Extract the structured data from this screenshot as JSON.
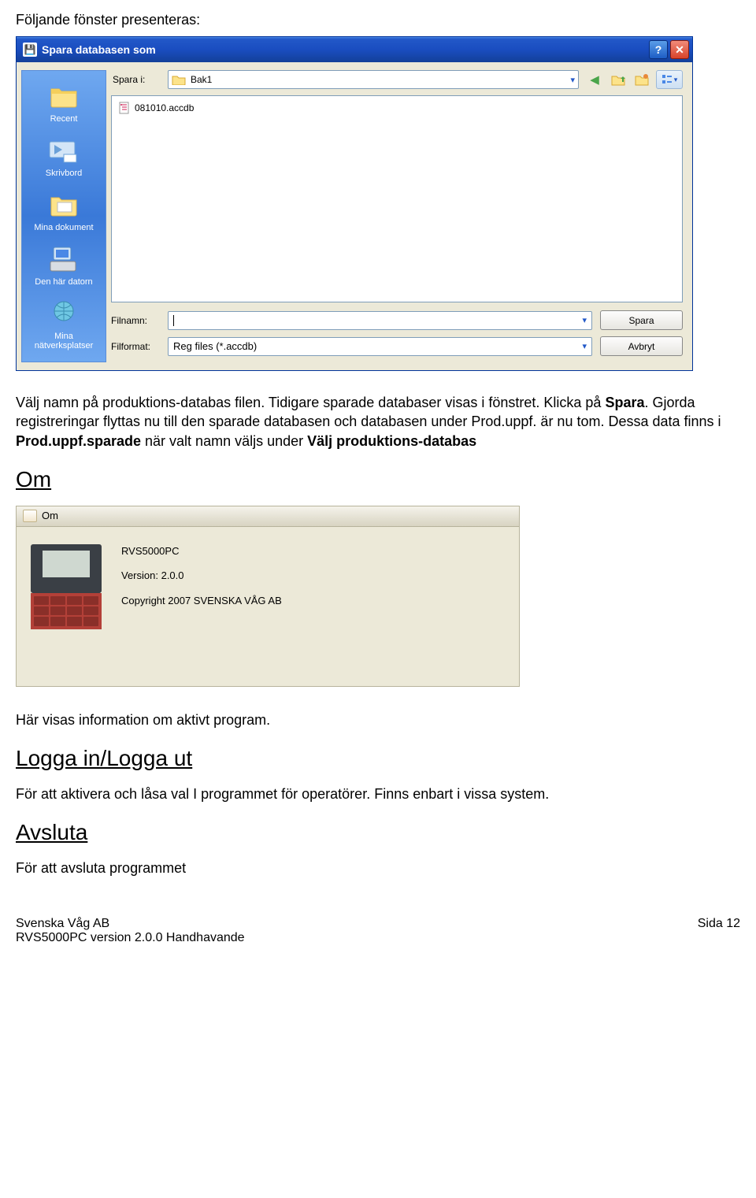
{
  "intro": "Följande fönster presenteras:",
  "dialog": {
    "title": "Spara databasen som",
    "save_in_label": "Spara i:",
    "save_in_value": "Bak1",
    "file_item": "081010.accdb",
    "places": [
      "Recent",
      "Skrivbord",
      "Mina dokument",
      "Den här datorn",
      "Mina nätverksplatser"
    ],
    "filename_label": "Filnamn:",
    "filetype_label": "Filformat:",
    "filetype_value": "Reg files (*.accdb)",
    "save_button": "Spara",
    "cancel_button": "Avbryt"
  },
  "doc": {
    "p1_a": "Välj namn på produktions-databas filen. Tidigare sparade databaser visas i fönstret. Klicka på ",
    "p1_b": "Spara",
    "p1_c": ". Gjorda registreringar flyttas nu till den sparade databasen och databasen under Prod.uppf. är nu tom. Dessa data finns i ",
    "p1_d": "Prod.uppf.sparade",
    "p1_e": " när valt namn väljs under ",
    "p1_f": "Välj produktions-databas",
    "h_om": "Om",
    "om_program": "RVS5000PC",
    "om_version": "Version: 2.0.0",
    "om_copyright": "Copyright 2007 SVENSKA VÅG AB",
    "om_window_title": "Om",
    "p2": "Här visas information om aktivt program.",
    "h_log": "Logga in/Logga ut",
    "p3": "För att aktivera och låsa val I programmet för operatörer. Finns enbart i vissa system.",
    "h_avsluta": "Avsluta",
    "p4": "För att avsluta programmet"
  },
  "footer": {
    "left1": "Svenska Våg AB",
    "left2": "RVS5000PC version 2.0.0 Handhavande",
    "right": "Sida 12"
  }
}
